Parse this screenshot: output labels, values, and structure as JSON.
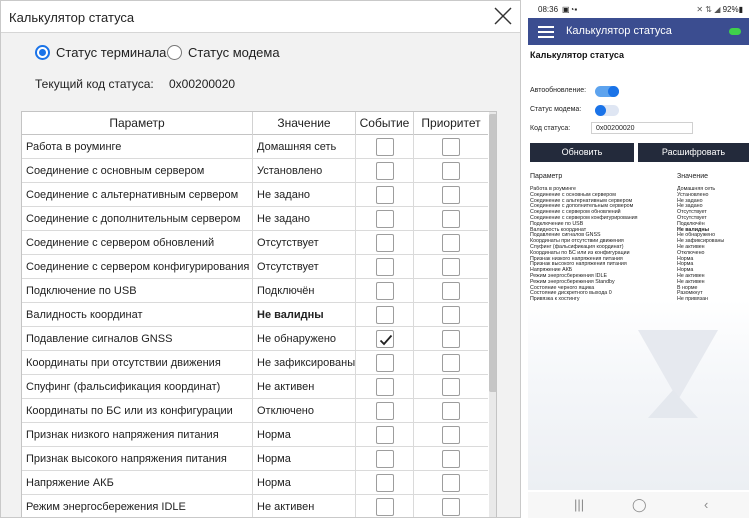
{
  "dialog": {
    "title": "Калькулятор статуса",
    "radio_terminal": "Статус терминала",
    "radio_modem": "Статус модема",
    "code_label": "Текущий код статуса:",
    "code_value": "0x00200020",
    "columns": [
      "Параметр",
      "Значение",
      "Событие",
      "Приоритет"
    ],
    "rows": [
      {
        "param": "Работа в роуминге",
        "value": "Домашняя сеть",
        "bold": false,
        "event": false
      },
      {
        "param": "Соединение с основным сервером",
        "value": "Установлено",
        "bold": false,
        "event": false
      },
      {
        "param": "Соединение с альтернативным сервером",
        "value": "Не задано",
        "bold": false,
        "event": false
      },
      {
        "param": "Соединение с дополнительным сервером",
        "value": "Не задано",
        "bold": false,
        "event": false
      },
      {
        "param": "Соединение с сервером обновлений",
        "value": "Отсутствует",
        "bold": false,
        "event": false
      },
      {
        "param": "Соединение с сервером конфигурирования",
        "value": "Отсутствует",
        "bold": false,
        "event": false
      },
      {
        "param": "Подключение по USB",
        "value": "Подключён",
        "bold": false,
        "event": false
      },
      {
        "param": "Валидность координат",
        "value": "Не валидны",
        "bold": true,
        "event": false
      },
      {
        "param": "Подавление сигналов GNSS",
        "value": "Не обнаружено",
        "bold": false,
        "event": true
      },
      {
        "param": "Координаты при отсутствии движения",
        "value": "Не зафиксированы",
        "bold": false,
        "event": false
      },
      {
        "param": "Спуфинг (фальсификация координат)",
        "value": "Не активен",
        "bold": false,
        "event": false
      },
      {
        "param": "Координаты по БС или из конфигурации",
        "value": "Отключено",
        "bold": false,
        "event": false
      },
      {
        "param": "Признак низкого напряжения питания",
        "value": "Норма",
        "bold": false,
        "event": false
      },
      {
        "param": "Признак высокого напряжения питания",
        "value": "Норма",
        "bold": false,
        "event": false
      },
      {
        "param": "Напряжение АКБ",
        "value": "Норма",
        "bold": false,
        "event": false
      },
      {
        "param": "Режим энергосбережения IDLE",
        "value": "Не активен",
        "bold": false,
        "event": false
      }
    ]
  },
  "phone": {
    "status_time": "08:36",
    "status_right": "92%",
    "app_title": "Калькулятор статуса",
    "heading": "Калькулятор статуса",
    "auto_update_label": "Автообновление:",
    "modem_status_label": "Статус модема:",
    "code_label": "Код статуса:",
    "code_value": "0x00200020",
    "btn_update": "Обновить",
    "btn_decode": "Расшифровать",
    "col_param": "Параметр",
    "col_value": "Значение",
    "rows": [
      {
        "n": "Работа в роуминге",
        "v": "Домашняя сеть",
        "bold": false
      },
      {
        "n": "Соединение с основным сервером",
        "v": "Установлено",
        "bold": false
      },
      {
        "n": "Соединение с альтернативным сервером",
        "v": "Не задано",
        "bold": false
      },
      {
        "n": "Соединение с дополнительным сервером",
        "v": "Не задано",
        "bold": false
      },
      {
        "n": "Соединение с сервером обновлений",
        "v": "Отсутствует",
        "bold": false
      },
      {
        "n": "Соединение с сервером конфигурирования",
        "v": "Отсутствует",
        "bold": false
      },
      {
        "n": "Подключение по USB",
        "v": "Подключён",
        "bold": false
      },
      {
        "n": "Валидность координат",
        "v": "Не валидны",
        "bold": true
      },
      {
        "n": "Подавление сигналов GNSS",
        "v": "Не обнаружено",
        "bold": false
      },
      {
        "n": "Координаты при отсутствии движения",
        "v": "Не зафиксированы",
        "bold": false
      },
      {
        "n": "Спуфинг (фальсификация координат)",
        "v": "Не активен",
        "bold": false
      },
      {
        "n": "Координаты по БС или из конфигурации",
        "v": "Отключено",
        "bold": false
      },
      {
        "n": "Признак низкого напряжения питания",
        "v": "Норма",
        "bold": false
      },
      {
        "n": "Признак высокого напряжения питания",
        "v": "Норма",
        "bold": false
      },
      {
        "n": "Напряжение АКБ",
        "v": "Норма",
        "bold": false
      },
      {
        "n": "Режим энергосбережения IDLE",
        "v": "Не активен",
        "bold": false
      },
      {
        "n": "Режим энергосбережения Standby",
        "v": "Не активен",
        "bold": false
      },
      {
        "n": "Состояние черного ящика",
        "v": "В норме",
        "bold": false
      },
      {
        "n": "Состояние дискретного выхода 0",
        "v": "Разомкнут",
        "bold": false
      },
      {
        "n": "Привязка к хостингу",
        "v": "Не привязан",
        "bold": false
      }
    ]
  }
}
